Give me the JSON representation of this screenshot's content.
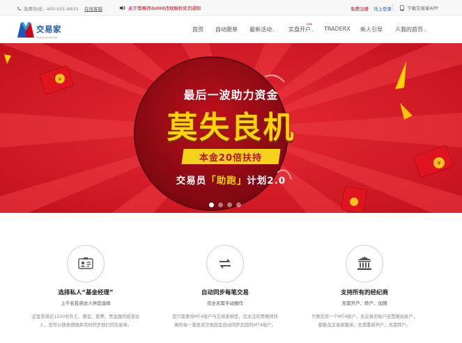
{
  "topbar": {
    "phone": "免费热线：400-001-8833",
    "online_service": "在线客服",
    "notice": "关于策略师ds888违规解析处罚通知",
    "register": "免费注册",
    "login": "马上登录",
    "download_app": "下载交易家APP"
  },
  "header": {
    "logo_text": "交易家",
    "logo_sub": "www.jiaoyijia.com",
    "nav": [
      {
        "label": "首页"
      },
      {
        "label": "自动跟单"
      },
      {
        "label": "最新活动",
        "caret": "⌄"
      },
      {
        "label": "实盘开户",
        "caret": "⌄",
        "badge": "new"
      },
      {
        "label": "TRADERX"
      },
      {
        "label": "新人引导"
      },
      {
        "label": "我的首页",
        "caret": "⌄"
      }
    ]
  },
  "banner": {
    "line1": "最后一波助力资金",
    "line2": "莫失良机",
    "line3": "本金20倍扶持",
    "line4_pre": "交易员",
    "line4_hl": "「助跑」",
    "line4_post": "计划2.0",
    "dots_total": 4,
    "dots_active_index": 0,
    "colors": {
      "red": "#d7192a",
      "dark_red": "#a5101d",
      "yellow": "#ffd400"
    }
  },
  "features": [
    {
      "icon": "id-card-icon",
      "title": "选择私人“基金经理”",
      "subtitle": "上千名投资达人供您选择",
      "desc": "这里有将近1500名外汇、黄金、股票、贵金属的投资达人，您可以随意跟随并实时同步他们的交易单。"
    },
    {
      "icon": "sync-icon",
      "title": "自动同步每笔交易",
      "subtitle": "完全无需手动操作",
      "desc": "您只需要将MT4账户与交易家绑定，您关注的策略师所做的每一笔投资交易就会自动同步到您的MT4账户。"
    },
    {
      "icon": "bank-icon",
      "title": "支持所有的经纪商",
      "subtitle": "无需开户、转户、加佣",
      "desc": "只要您有一个MT4账户，无论真实账户还是模拟账户，都能在交易家跟单，无需重新开户，无需转户。"
    }
  ]
}
